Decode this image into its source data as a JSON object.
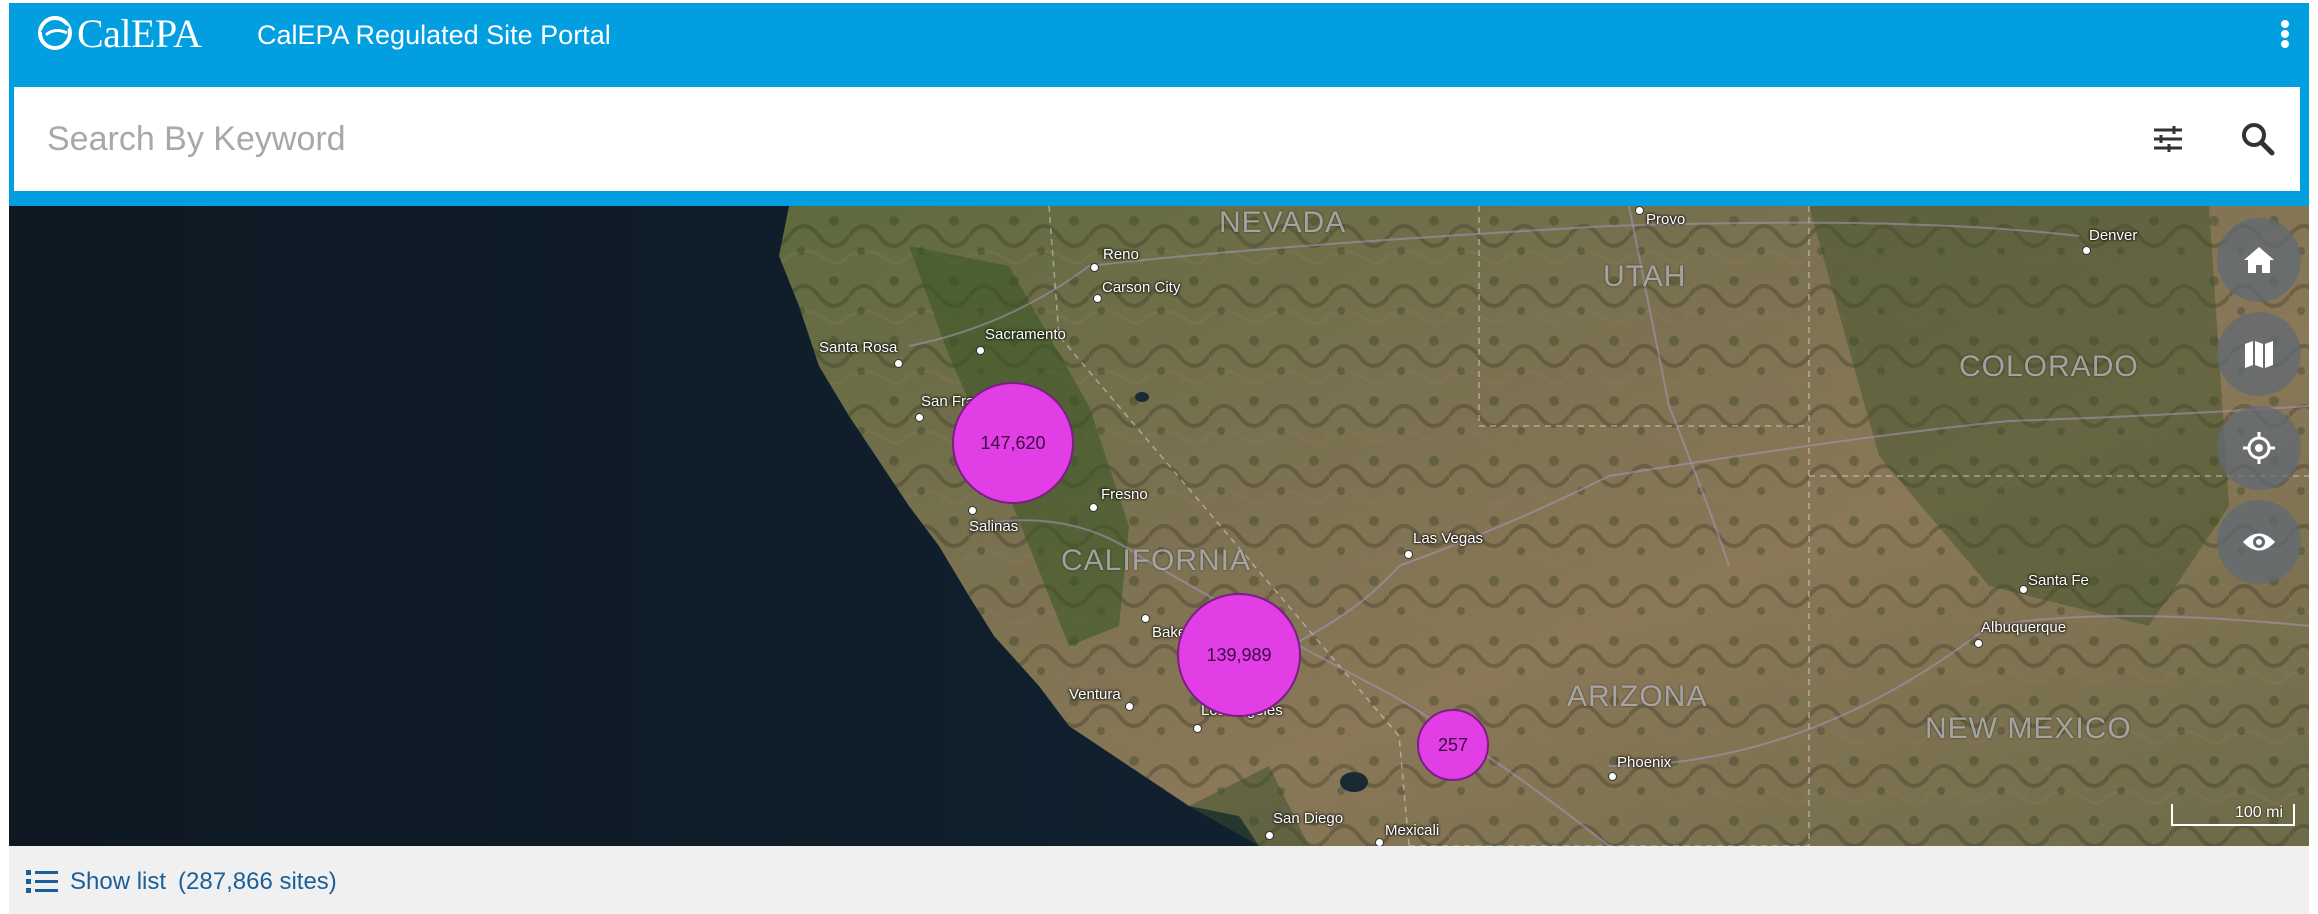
{
  "header": {
    "brand": "CalEPA",
    "title": "CalEPA Regulated Site Portal"
  },
  "search": {
    "placeholder": "Search By Keyword",
    "value": ""
  },
  "map": {
    "states": [
      "NEVADA",
      "UTAH",
      "COLORADO",
      "CALIFORNIA",
      "ARIZONA",
      "NEW MEXICO"
    ],
    "cities": [
      "Provo",
      "Denver",
      "Reno",
      "Carson City",
      "Sacramento",
      "Santa Rosa",
      "San Francisco",
      "Fresno",
      "Salinas",
      "Las Vegas",
      "Santa Fe",
      "Albuquerque",
      "Bakersfield",
      "Ventura",
      "Los Angeles",
      "Phoenix",
      "San Diego",
      "Mexicali"
    ],
    "clusters": [
      {
        "label": "147,620"
      },
      {
        "label": "139,989"
      },
      {
        "label": "257"
      }
    ],
    "scale_label": "100 mi",
    "controls": [
      "home-icon",
      "basemap-icon",
      "locate-icon",
      "visibility-icon"
    ],
    "cluster_color": "#e13ee6"
  },
  "footer": {
    "show_list_label": "Show list",
    "site_count": "(287,866 sites)"
  },
  "colors": {
    "brand": "#019ee0",
    "link": "#1a5f9a"
  }
}
